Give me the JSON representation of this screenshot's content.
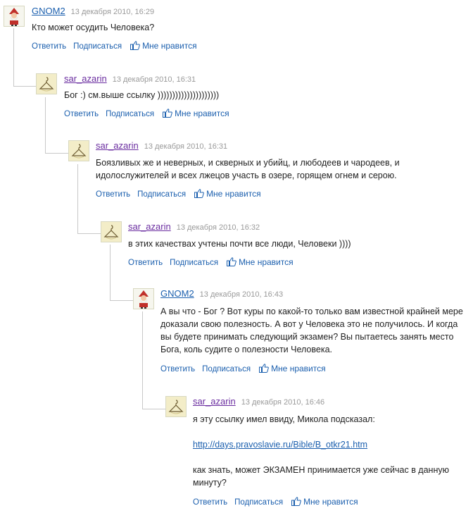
{
  "icons": {
    "avatar_gnom": "gnome-avatar-icon",
    "avatar_sar": "hanger-avatar-icon",
    "like": "thumbs-up-icon"
  },
  "colors": {
    "link": "#1b5fae",
    "author_sar": "#6b2ea0",
    "date": "#9a9a9a",
    "thread_line": "#c8c8c8"
  },
  "comments": [
    {
      "author": "GNOM2",
      "date": "13 декабря 2010, 16:29",
      "text": [
        "Кто может осудить Человека?"
      ],
      "reply": "Ответить",
      "subscribe": "Подписаться",
      "like": "Мне нравится"
    },
    {
      "author": "sar_azarin",
      "date": "13 декабря 2010, 16:31",
      "text": [
        "Бог :) см.выше ссылку )))))))))))))))))))))"
      ],
      "reply": "Ответить",
      "subscribe": "Подписаться",
      "like": "Мне нравится"
    },
    {
      "author": "sar_azarin",
      "date": "13 декабря 2010, 16:31",
      "text": [
        "Боязливых же и неверных, и скверных и убийц, и любодеев и чародеев, и идолослужителей и всех лжецов участь в озере, горящем огнем и серою."
      ],
      "reply": "Ответить",
      "subscribe": "Подписаться",
      "like": "Мне нравится"
    },
    {
      "author": "sar_azarin",
      "date": "13 декабря 2010, 16:32",
      "text": [
        "в этих качествах учтены почти все люди, Человеки ))))"
      ],
      "reply": "Ответить",
      "subscribe": "Подписаться",
      "like": "Мне нравится"
    },
    {
      "author": "GNOM2",
      "date": "13 декабря 2010, 16:43",
      "text": [
        "А вы что - Бог ? Вот куры по какой-то только вам известной крайней мере доказали свою полезность. А вот у Человека это не получилось. И когда вы будете принимать следующий экзамен? Вы пытаетесь занять место Бога, коль судите о полезности Человека."
      ],
      "reply": "Ответить",
      "subscribe": "Подписаться",
      "like": "Мне нравится"
    },
    {
      "author": "sar_azarin",
      "date": "13 декабря 2010, 16:46",
      "text": [
        "я эту ссылку имел ввиду, Микола подсказал:"
      ],
      "link": "http://days.pravoslavie.ru/Bible/B_otkr21.htm",
      "text2": "как знать, может ЭКЗАМЕН принимается уже сейчас в данную минуту?",
      "reply": "Ответить",
      "subscribe": "Подписаться",
      "like": "Мне нравится"
    }
  ]
}
